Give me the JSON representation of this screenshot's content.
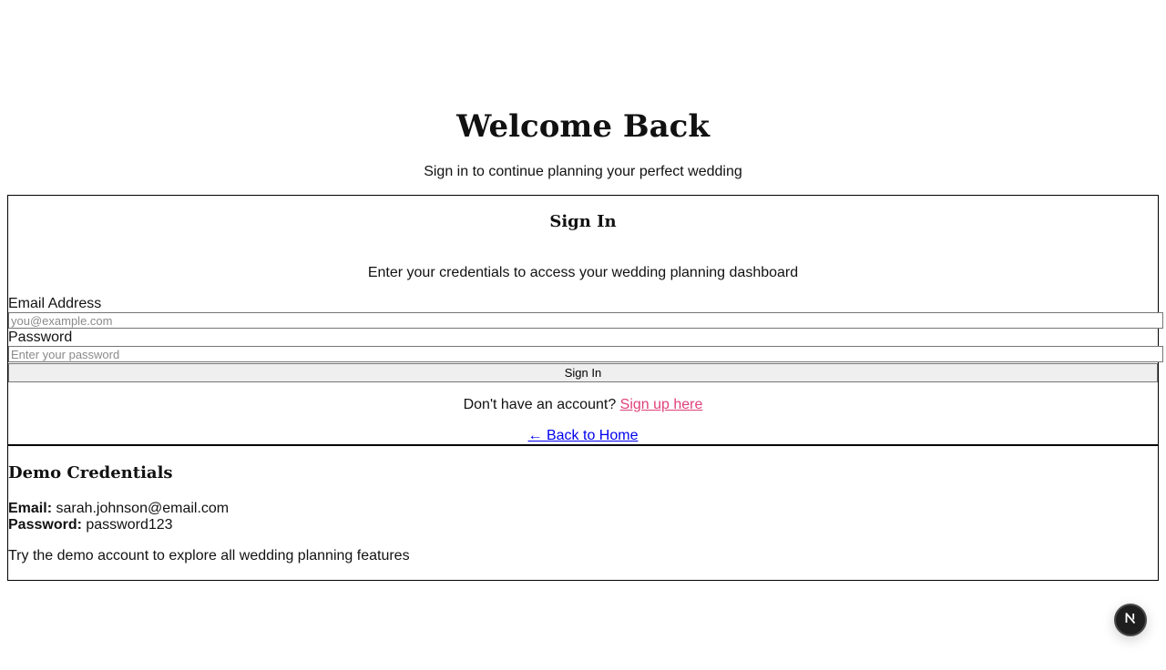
{
  "hero": {
    "title": "Welcome Back",
    "subtitle": "Sign in to continue planning your perfect wedding"
  },
  "signin_card": {
    "title": "Sign In",
    "description": "Enter your credentials to access your wedding planning dashboard",
    "email_label": "Email Address",
    "email_placeholder": "you@example.com",
    "email_value": "",
    "password_label": "Password",
    "password_placeholder": "Enter your password",
    "password_value": "",
    "submit_label": "Sign In",
    "signup_prompt": "Don't have an account? ",
    "signup_link": "Sign up here",
    "back_link": "← Back to Home"
  },
  "demo": {
    "title": "Demo Credentials",
    "email_key": "Email:",
    "email_value": " sarah.johnson@email.com",
    "password_key": "Password:",
    "password_value": " password123",
    "note": "Try the demo account to explore all wedding planning features"
  },
  "dev_badge": {
    "icon": "next-logo-icon",
    "bg_color": "#1e1e1e"
  },
  "colors": {
    "signup_link": "#e0407a",
    "back_link": "#0000ee"
  }
}
